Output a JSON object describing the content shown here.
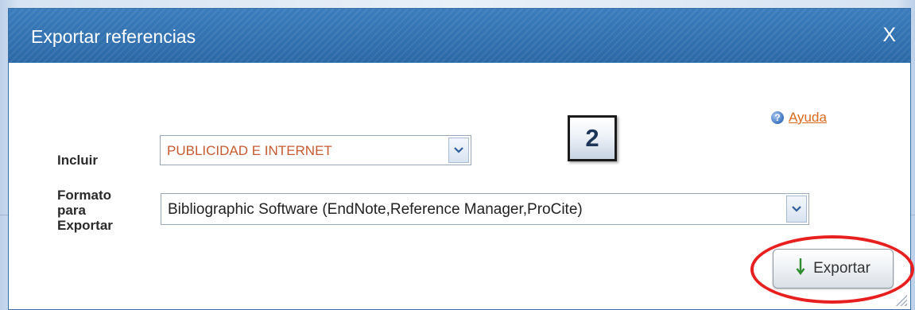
{
  "dialog": {
    "title": "Exportar referencias",
    "close_label": "X"
  },
  "help": {
    "icon": "help-circle-icon",
    "label": "Ayuda"
  },
  "step_badge": "2",
  "form": {
    "incluir": {
      "label": "Incluir",
      "selected": "PUBLICIDAD E INTERNET"
    },
    "formato": {
      "label": "Formato\npara\nExportar",
      "selected": "Bibliographic Software (EndNote,Reference Manager,ProCite)"
    }
  },
  "export_button": {
    "icon": "down-arrow-icon",
    "label": "Exportar"
  },
  "colors": {
    "titlebar": "#2f6fad",
    "link": "#d96a1e",
    "incluir_value": "#c75a30",
    "highlight": "#e81f1f",
    "arrow_green": "#2e8b2e"
  }
}
